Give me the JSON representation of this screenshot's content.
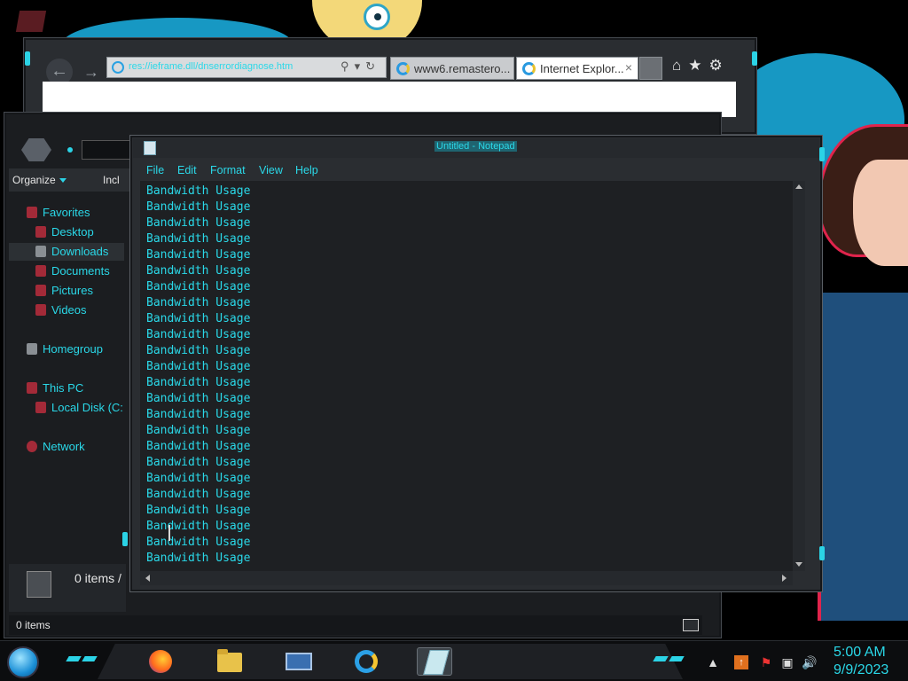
{
  "ie": {
    "address_url": "res://ieframe.dll/dnserrordiagnose.htm",
    "tabs": [
      {
        "label": "www6.remastero...",
        "active": false
      },
      {
        "label": "Internet Explor...",
        "active": true,
        "close": "×"
      }
    ],
    "toolbar_icons": [
      "home-icon",
      "favorites-star-icon",
      "settings-gear-icon"
    ]
  },
  "explorer": {
    "command_bar": {
      "organize": "Organize",
      "include": "Incl"
    },
    "nav": {
      "favorites": "Favorites",
      "desktop": "Desktop",
      "downloads": "Downloads",
      "documents": "Documents",
      "pictures": "Pictures",
      "videos": "Videos",
      "homegroup": "Homegroup",
      "this_pc": "This PC",
      "local_disk": "Local Disk (C:",
      "network": "Network"
    },
    "details_count": "0 items /",
    "status_text": "0 items"
  },
  "notepad": {
    "title": "Untitled - Notepad",
    "menu": {
      "file": "File",
      "edit": "Edit",
      "format": "Format",
      "view": "View",
      "help": "Help"
    },
    "lines": [
      "Bandwidth Usage",
      "Bandwidth Usage",
      "Bandwidth Usage",
      "Bandwidth Usage",
      "Bandwidth Usage",
      "Bandwidth Usage",
      "Bandwidth Usage",
      "Bandwidth Usage",
      "Bandwidth Usage",
      "Bandwidth Usage",
      "Bandwidth Usage",
      "Bandwidth Usage",
      "Bandwidth Usage",
      "Bandwidth Usage",
      "Bandwidth Usage",
      "Bandwidth Usage",
      "Bandwidth Usage",
      "Bandwidth Usage",
      "Bandwidth Usage",
      "Bandwidth Usage",
      "Bandwidth Usage",
      "Bandwidth Usage",
      "Bandwidth Usage",
      "Bandwidth Usage"
    ]
  },
  "taskbar": {
    "apps": [
      "firefox-icon",
      "file-explorer-icon",
      "media-center-icon",
      "internet-explorer-icon",
      "notepad-icon"
    ],
    "clock": {
      "time": "5:00 AM",
      "date": "9/9/2023"
    }
  },
  "theme": {
    "accent": "#2ad8e8",
    "window_dark": "#2a2d31",
    "editor_bg": "#1e2023"
  }
}
